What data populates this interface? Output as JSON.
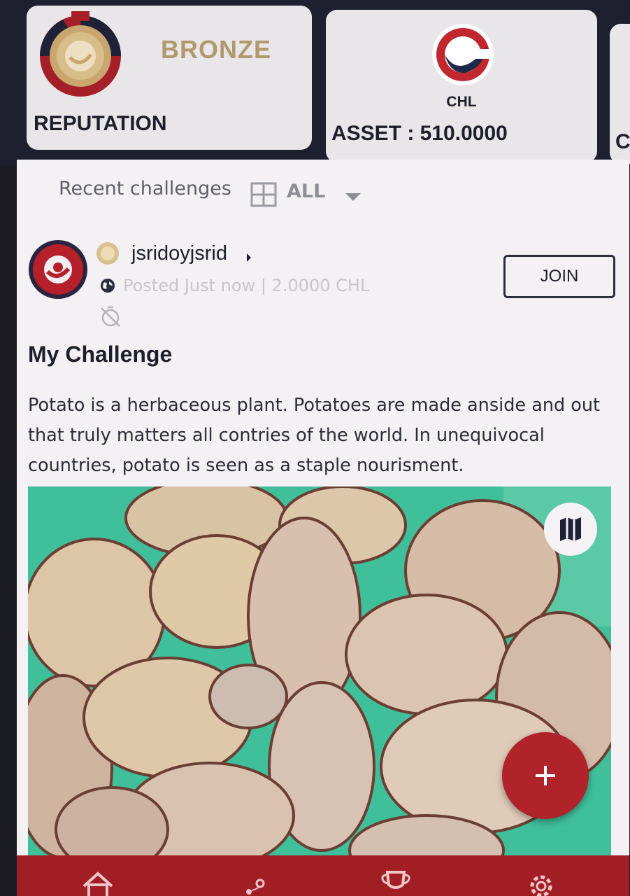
{
  "reputation": {
    "level": "BRONZE",
    "label": "REPUTATION"
  },
  "asset": {
    "symbol": "CHL",
    "label": "ASSET : 510.0000"
  },
  "third_card": {
    "label": "C"
  },
  "filter": {
    "label": "Recent challenges",
    "value": "ALL"
  },
  "post": {
    "username": "jsridoyjsrid",
    "meta": "Posted Just now | 2.0000 CHL",
    "join_label": "JOIN",
    "title": "My Challenge",
    "body": "Potato is a herbaceous plant. Potatoes are made anside and out that truly matters all contries of the world. In unequivocal countries, potato is seen as a staple nourisment."
  },
  "fab": {
    "label": "+"
  },
  "nav": {
    "items": [
      "home-icon",
      "map-route-icon",
      "trophy-icon",
      "settings-icon"
    ]
  },
  "colors": {
    "brand_red": "#a11e24",
    "fab_red": "#b0232a",
    "dark_bg": "#1e2030",
    "bronze": "#b09a6c"
  }
}
